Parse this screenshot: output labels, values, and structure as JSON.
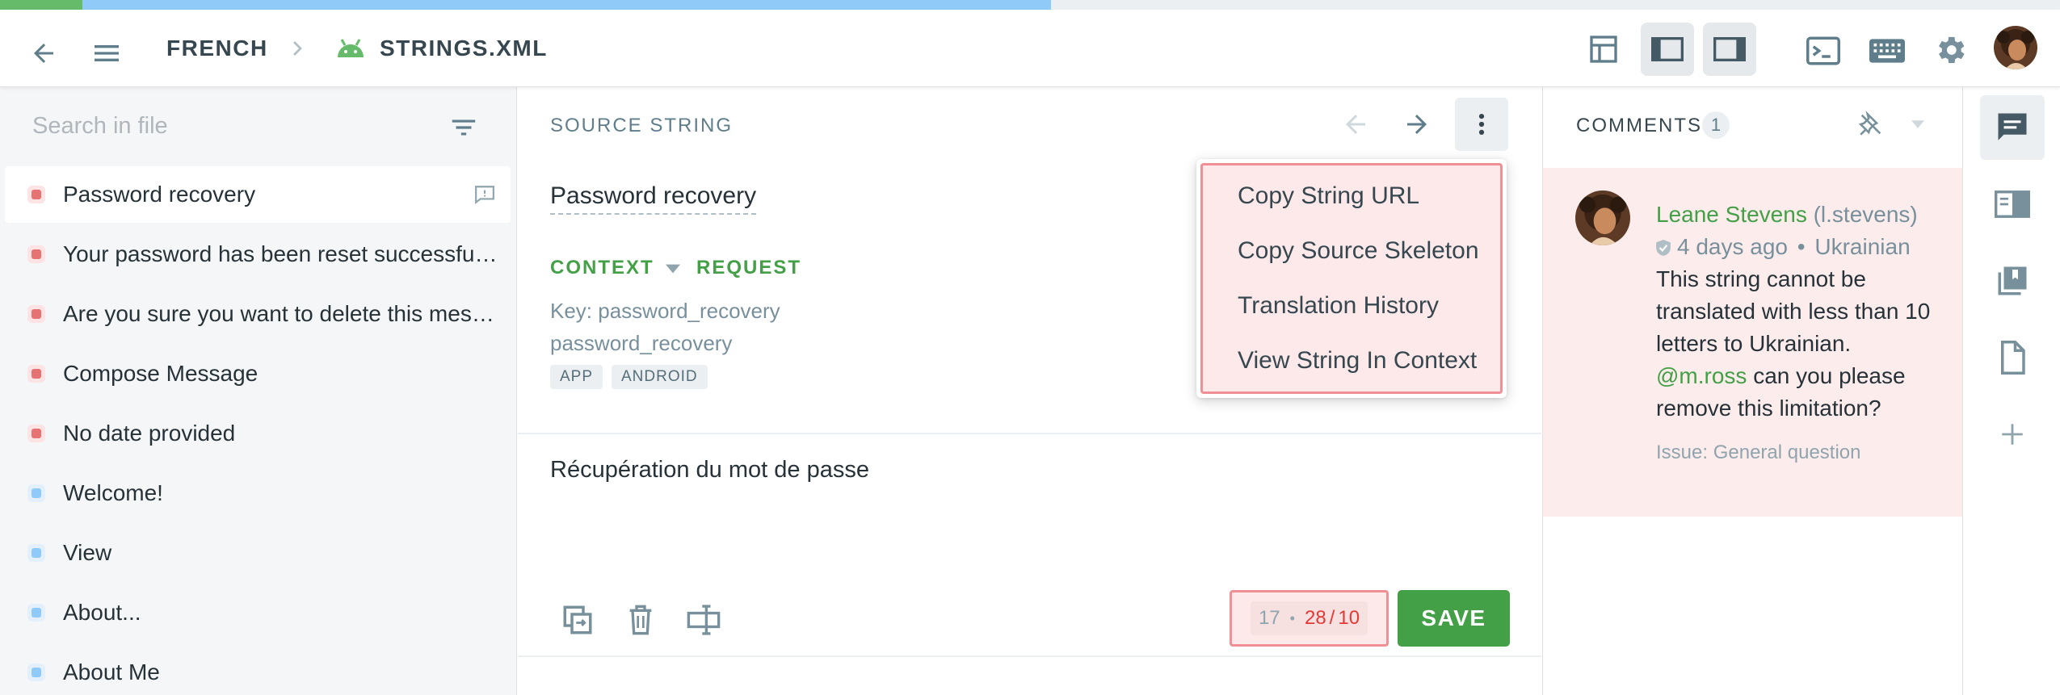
{
  "progress": {
    "approved_fraction": 0.04,
    "translated_fraction": 0.51
  },
  "breadcrumb": {
    "language": "FRENCH",
    "file": "STRINGS.XML"
  },
  "icons": {
    "back": "arrow-left-icon",
    "menu": "hamburger-menu-icon",
    "chevron": "chevron-right-icon",
    "android": "android-icon",
    "layout_grid": "layout-grid-icon",
    "layout_left": "layout-left-panel-icon",
    "layout_right": "layout-right-panel-icon",
    "terminal": "terminal-icon",
    "keyboard": "keyboard-icon",
    "settings": "gear-icon",
    "filter": "filter-icon"
  },
  "search": {
    "placeholder": "Search in file"
  },
  "strings": [
    {
      "text": "Password recovery",
      "status": "untranslated",
      "selected": true,
      "has_comment": true
    },
    {
      "text": "Your password has been reset successfully!",
      "status": "untranslated"
    },
    {
      "text": "Are you sure you want to delete this message?",
      "status": "untranslated"
    },
    {
      "text": "Compose Message",
      "status": "untranslated"
    },
    {
      "text": "No date provided",
      "status": "untranslated"
    },
    {
      "text": "Welcome!",
      "status": "translated"
    },
    {
      "text": "View",
      "status": "translated"
    },
    {
      "text": "About...",
      "status": "translated"
    },
    {
      "text": "About Me",
      "status": "translated"
    }
  ],
  "source": {
    "header": "SOURCE STRING",
    "text": "Password recovery",
    "context_label": "CONTEXT",
    "request_label": "REQUEST",
    "key_line": "Key: password_recovery",
    "identifier": "password_recovery",
    "tags": [
      "APP",
      "ANDROID"
    ]
  },
  "menu": {
    "items": [
      "Copy String URL",
      "Copy Source Skeleton",
      "Translation History",
      "View String In Context"
    ]
  },
  "translation": {
    "text": "Récupération du mot de passe"
  },
  "counter": {
    "source_length": "17",
    "separator": "•",
    "translation_length": "28",
    "max_length": "10"
  },
  "save_label": "SAVE",
  "comments": {
    "title": "COMMENTS",
    "count": "1",
    "author": "Leane Stevens",
    "username": "(l.stevens)",
    "time": "4 days ago",
    "dot": "•",
    "language": "Ukrainian",
    "body_lines": [
      "This string cannot be",
      "translated with less than 10",
      "letters to Ukrainian."
    ],
    "mention": "@m.ross",
    "mention_rest": "can you please",
    "last_line": "remove this limitation?",
    "issue": "Issue: General question"
  },
  "colors": {
    "accent_green": "#43a047",
    "error_red": "#e53935",
    "highlight": "#f08f95"
  }
}
